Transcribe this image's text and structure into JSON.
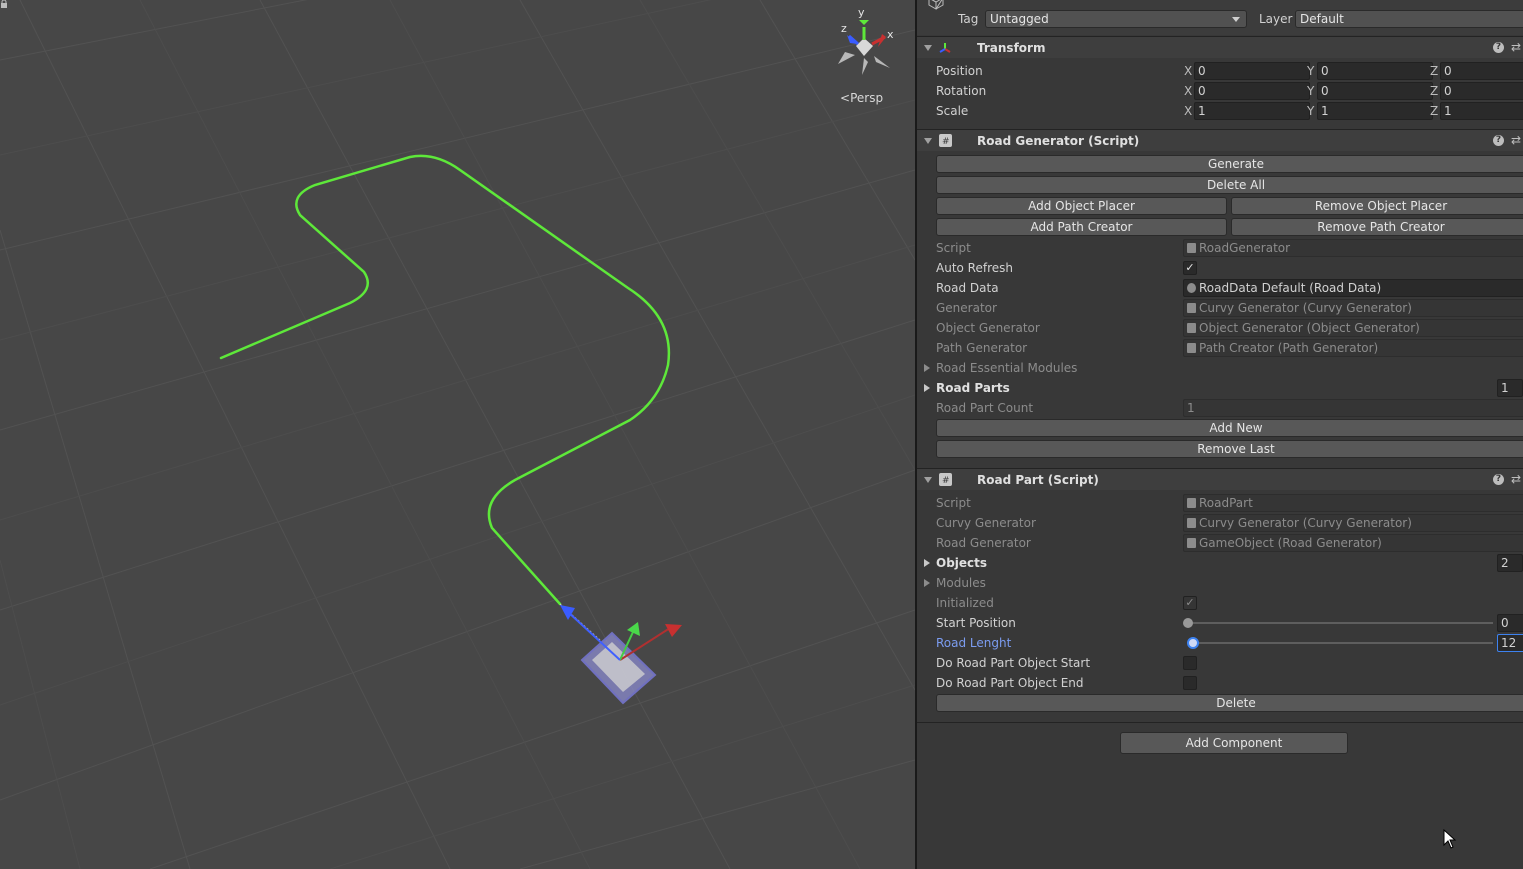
{
  "scene": {
    "persp_label": "Persp",
    "gizmo_axes": {
      "x": "x",
      "y": "y",
      "z": "z"
    }
  },
  "object_header": {
    "tag_label": "Tag",
    "tag_value": "Untagged",
    "layer_label": "Layer",
    "layer_value": "Default"
  },
  "transform": {
    "title": "Transform",
    "rows": [
      {
        "label": "Position",
        "x": "0",
        "y": "0",
        "z": "0"
      },
      {
        "label": "Rotation",
        "x": "0",
        "y": "0",
        "z": "0"
      },
      {
        "label": "Scale",
        "x": "1",
        "y": "1",
        "z": "1"
      }
    ],
    "axis_labels": {
      "x": "X",
      "y": "Y",
      "z": "Z"
    }
  },
  "road_generator": {
    "title": "Road Generator (Script)",
    "buttons": {
      "generate": "Generate",
      "delete_all": "Delete All",
      "add_object_placer": "Add Object Placer",
      "remove_object_placer": "Remove Object Placer",
      "add_path_creator": "Add Path Creator",
      "remove_path_creator": "Remove Path Creator",
      "add_new": "Add New",
      "remove_last": "Remove Last"
    },
    "script_label": "Script",
    "script_value": "RoadGenerator",
    "auto_refresh_label": "Auto Refresh",
    "auto_refresh_checked": true,
    "road_data_label": "Road Data",
    "road_data_value": "RoadData Default (Road Data)",
    "generator_label": "Generator",
    "generator_value": "Curvy Generator (Curvy Generator)",
    "object_generator_label": "Object Generator",
    "object_generator_value": "Object Generator (Object Generator)",
    "path_generator_label": "Path Generator",
    "path_generator_value": "Path Creator (Path Generator)",
    "essential_modules_label": "Road Essential Modules",
    "road_parts_label": "Road Parts",
    "road_parts_size": "1",
    "road_part_count_label": "Road Part Count",
    "road_part_count_value": "1"
  },
  "road_part": {
    "title": "Road Part (Script)",
    "script_label": "Script",
    "script_value": "RoadPart",
    "curvy_generator_label": "Curvy Generator",
    "curvy_generator_value": "Curvy Generator (Curvy Generator)",
    "road_generator_label": "Road Generator",
    "road_generator_value": "GameObject (Road Generator)",
    "objects_label": "Objects",
    "objects_size": "2",
    "modules_label": "Modules",
    "initialized_label": "Initialized",
    "initialized_checked": true,
    "start_position_label": "Start Position",
    "start_position_value": "0",
    "road_length_label": "Road Lenght",
    "road_length_value": "12",
    "start_obj_label": "Do Road Part Object Start",
    "end_obj_label": "Do Road Part Object End",
    "delete_button": "Delete"
  },
  "add_component_button": "Add Component",
  "colors": {
    "scene_bg": "#474747",
    "inspector_bg": "#383838",
    "road_line": "#5ee83a",
    "highlight": "#7b9cf0",
    "accent": "#3d82f0"
  }
}
